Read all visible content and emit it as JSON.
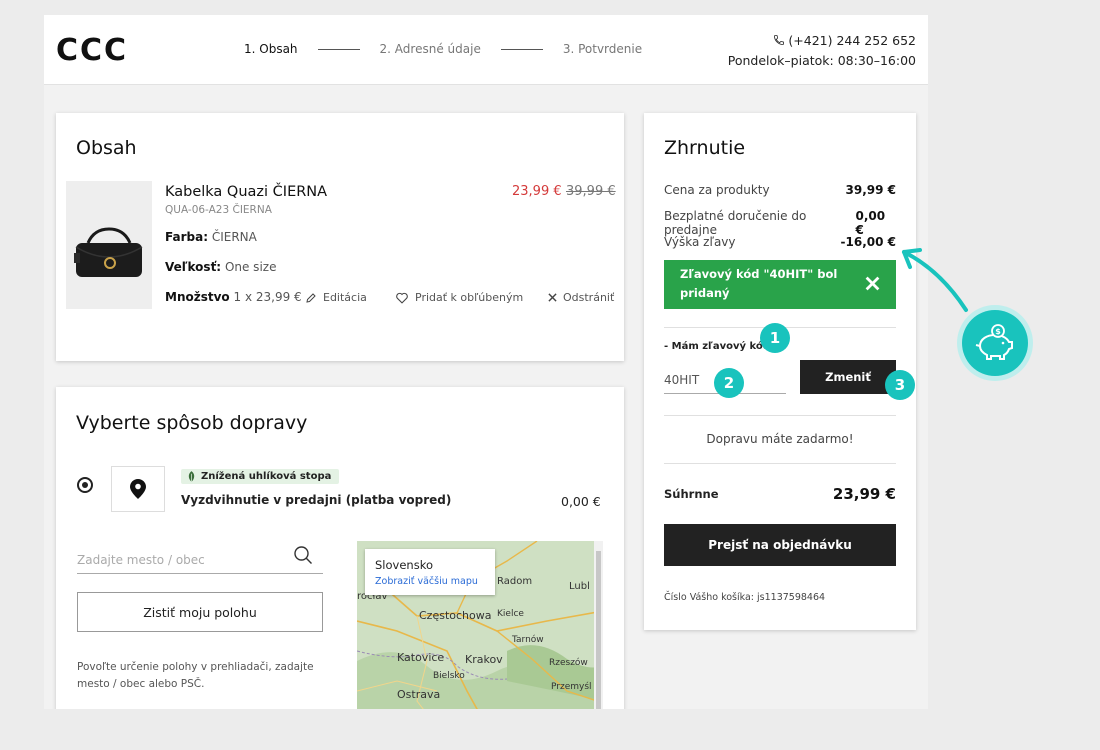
{
  "header": {
    "logo": "CCC",
    "steps": [
      "1. Obsah",
      "2. Adresné údaje",
      "3. Potvrdenie"
    ],
    "phone": "(+421) 244 252 652",
    "hours": "Pondelok–piatok: 08:30–16:00"
  },
  "cart": {
    "title": "Obsah",
    "product": {
      "name": "Kabelka Quazi ČIERNA",
      "sku": "QUA-06-A23 ČIERNA",
      "color_label": "Farba:",
      "color_value": "ČIERNA",
      "size_label": "Veľkosť:",
      "size_value": "One size",
      "qty_label": "Množstvo",
      "qty_value": "1 x 23,99 €",
      "price_new": "23,99 €",
      "price_old": "39,99 €"
    },
    "actions": {
      "edit": "Editácia",
      "favorite": "Pridať k obľúbeným",
      "remove": "Odstrániť"
    }
  },
  "shipping": {
    "title": "Vyberte spôsob dopravy",
    "eco_badge": "Znížená uhlíková stopa",
    "option_label": "Vyzdvihnutie v predajni (platba vopred)",
    "option_price": "0,00 €",
    "city_placeholder": "Zadajte mesto / obec",
    "locate_button": "Zistiť moju polohu",
    "help_text": "Povoľte určenie polohy v prehliadači, zadajte mesto / obec alebo PSČ.",
    "map": {
      "popup_title": "Slovensko",
      "popup_link": "Zobraziť väčšiu mapu",
      "cities": [
        "Radom",
        "Lubl",
        "rocłav",
        "Częstochowa",
        "Kielce",
        "Tarnów",
        "Katovice",
        "Krakov",
        "Rzeszów",
        "Bielsko",
        "Przemyśl",
        "Ostrava"
      ]
    }
  },
  "summary": {
    "title": "Zhrnutie",
    "rows": [
      {
        "label": "Cena za produkty",
        "value": "39,99 €"
      },
      {
        "label": "Bezplatné doručenie do predajne",
        "value": "0,00 €"
      },
      {
        "label": "Výška zľavy",
        "value": "-16,00 €"
      }
    ],
    "promo_success_line1": "Zľavový kód \"40HIT\" bol",
    "promo_success_line2": "pridaný",
    "promo_label": "- Mám zľavový kód",
    "promo_value": "40HIT",
    "apply_button": "Zmeniť",
    "free_shipping": "Dopravu máte zadarmo!",
    "total_label": "Súhrnne",
    "total_value": "23,99 €",
    "order_button": "Prejsť na objednávku",
    "cart_id": "Číslo Vášho košíka: js1137598464"
  },
  "badges": [
    "1",
    "2",
    "3"
  ],
  "colors": {
    "accent": "#19c3bd",
    "success": "#29a34a",
    "sale": "#d43a3a",
    "dark": "#222222"
  }
}
